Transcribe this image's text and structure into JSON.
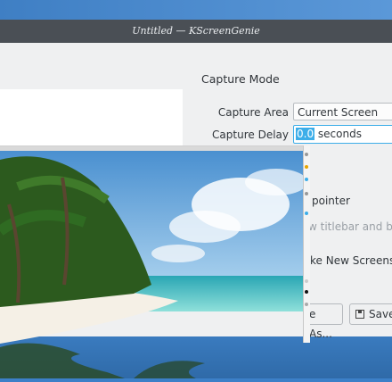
{
  "window": {
    "title": "Untitled — KScreenGenie"
  },
  "capture_mode": {
    "title": "Capture Mode",
    "area_label": "Capture Area",
    "area_value": "Current Screen",
    "delay_label": "Capture Delay",
    "delay_value": "0.0",
    "delay_unit": "seconds"
  },
  "options": {
    "pointer": "pointer",
    "titlebar": "w titlebar and bor",
    "take_new": "ke New Screensho"
  },
  "buttons": {
    "save_as": "e As...",
    "save": "Save"
  },
  "colors": {
    "accent": "#3daee9",
    "titlebar": "#4a4f55",
    "window_bg": "#eff0f1"
  }
}
